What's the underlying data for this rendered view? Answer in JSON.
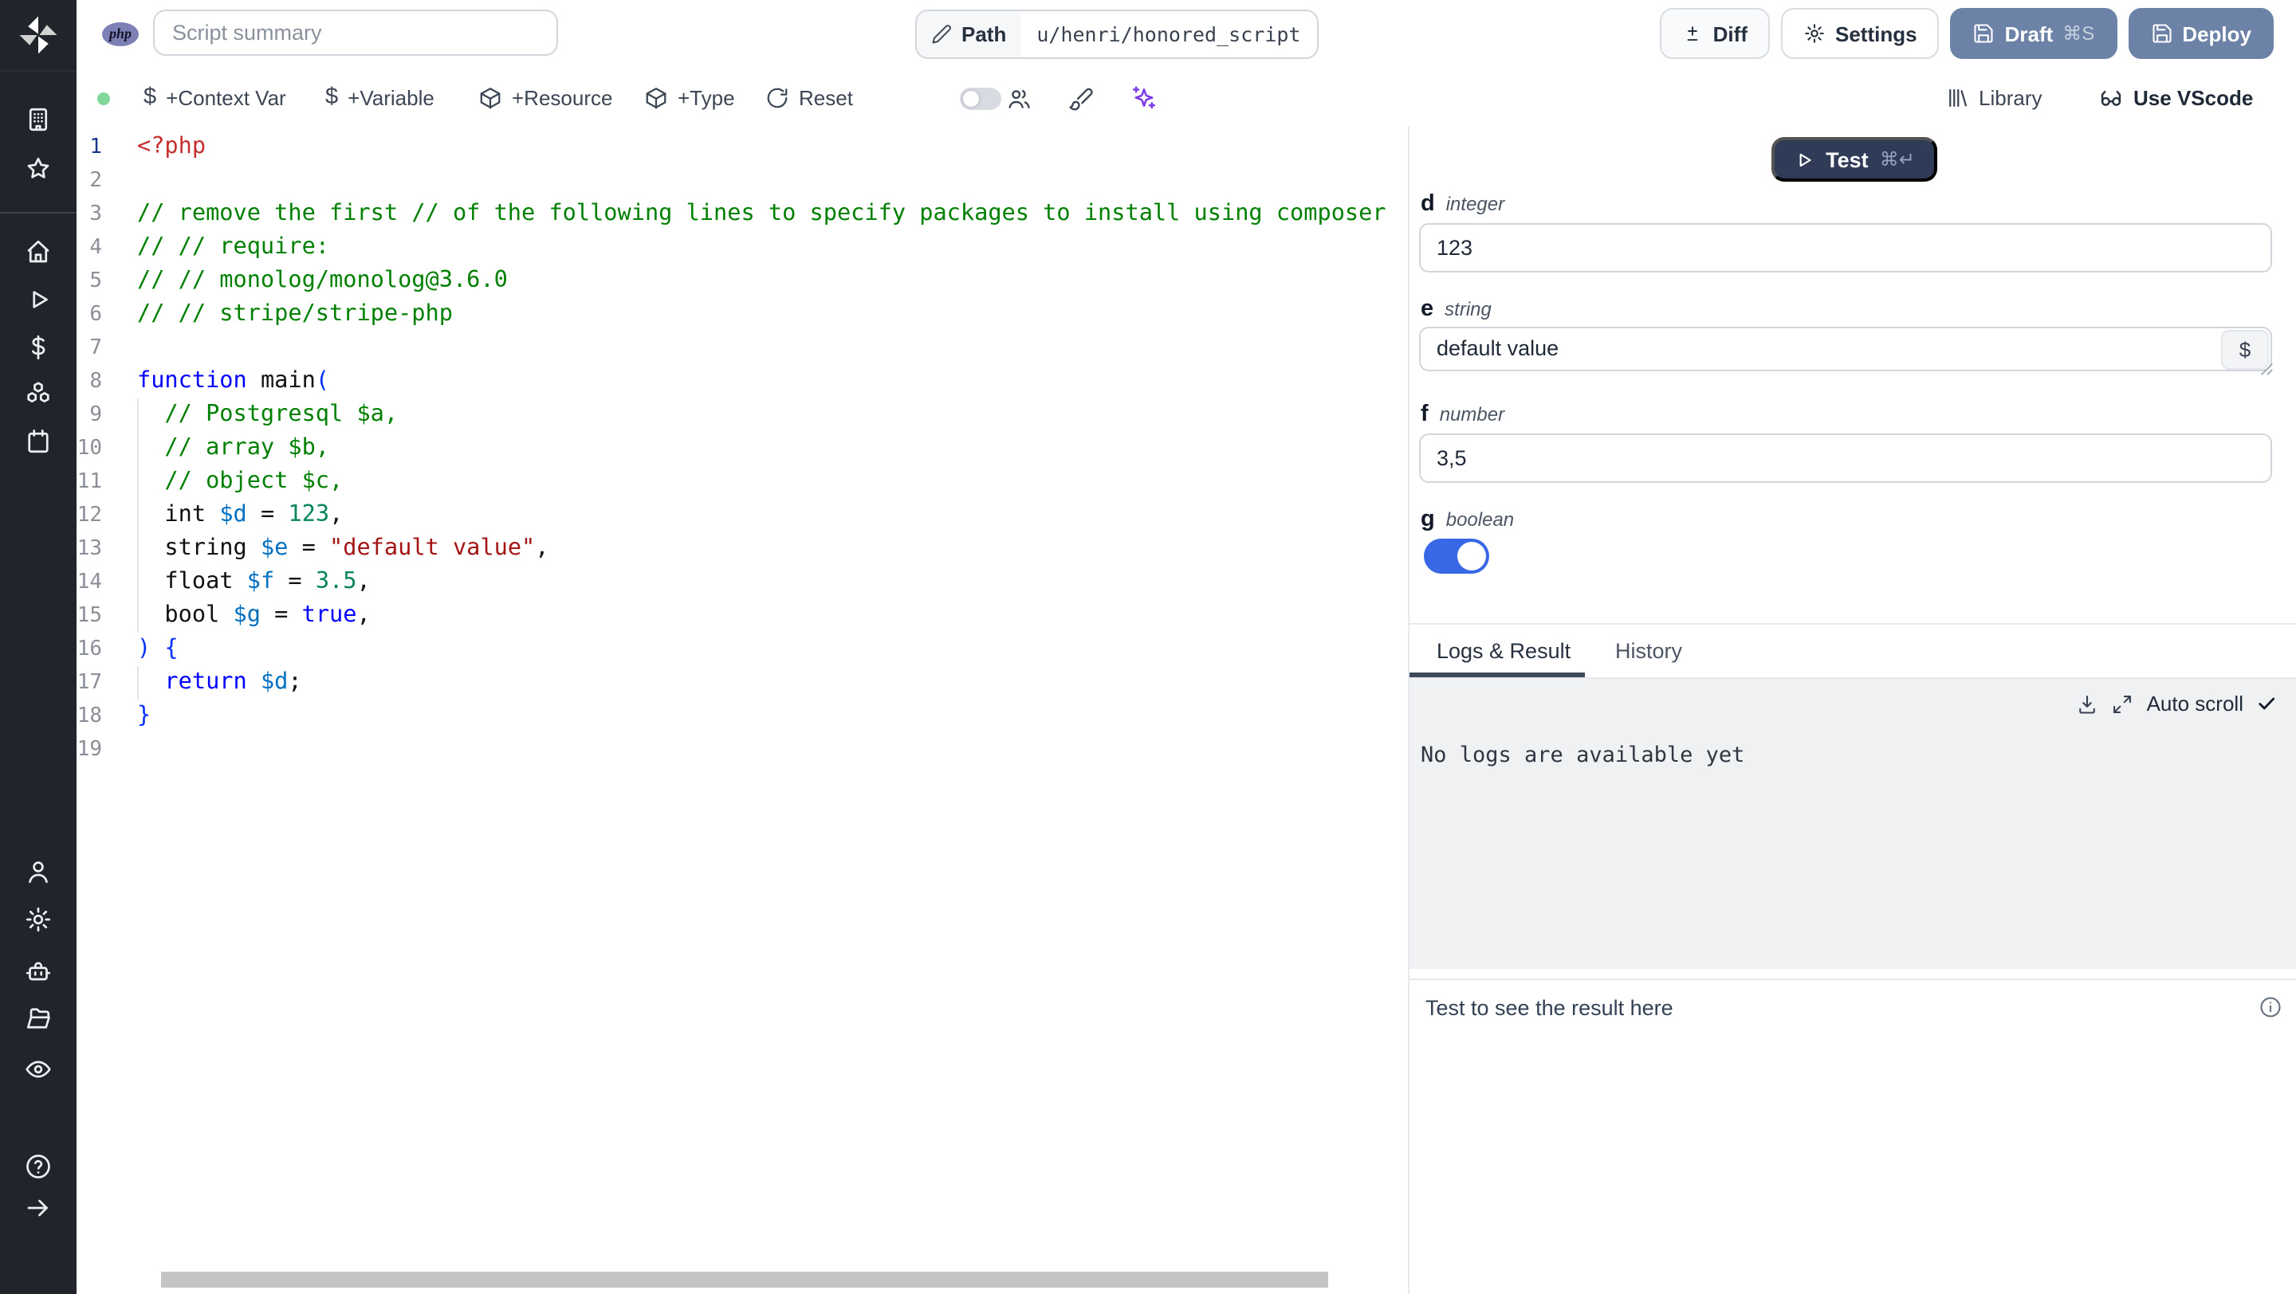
{
  "topbar": {
    "language_badge": "php",
    "summary_placeholder": "Script summary",
    "path": {
      "label": "Path",
      "value": "u/henri/honored_script"
    },
    "buttons": {
      "diff": "Diff",
      "settings": "Settings",
      "draft": "Draft",
      "draft_shortcut": "⌘S",
      "deploy": "Deploy"
    }
  },
  "toolbar": {
    "add_context_var": "+Context Var",
    "add_variable": "+Variable",
    "add_resource": "+Resource",
    "add_type": "+Type",
    "reset": "Reset",
    "diff_mode_toggle_on": false,
    "library": "Library",
    "use_vscode": "Use VScode"
  },
  "editor": {
    "language": "php",
    "active_line": 1,
    "total_lines": 19,
    "lines": [
      [
        [
          "meta",
          "<?php"
        ]
      ],
      [],
      [
        [
          "com",
          "// remove the first // of the following lines to specify packages to install using composer"
        ]
      ],
      [
        [
          "com",
          "// // require:"
        ]
      ],
      [
        [
          "com",
          "// // monolog/monolog@3.6.0"
        ]
      ],
      [
        [
          "com",
          "// // stripe/stripe-php"
        ]
      ],
      [],
      [
        [
          "kw",
          "function"
        ],
        [
          "pl",
          " main"
        ],
        [
          "br",
          "("
        ]
      ],
      [
        [
          "com",
          "  // Postgresql $a,"
        ]
      ],
      [
        [
          "com",
          "  // array $b,"
        ]
      ],
      [
        [
          "com",
          "  // object $c,"
        ]
      ],
      [
        [
          "pl",
          "  int "
        ],
        [
          "var",
          "$d"
        ],
        [
          "pl",
          " = "
        ],
        [
          "num",
          "123"
        ],
        [
          "pl",
          ","
        ]
      ],
      [
        [
          "pl",
          "  string "
        ],
        [
          "var",
          "$e"
        ],
        [
          "pl",
          " = "
        ],
        [
          "str",
          "\"default value\""
        ],
        [
          "pl",
          ","
        ]
      ],
      [
        [
          "pl",
          "  float "
        ],
        [
          "var",
          "$f"
        ],
        [
          "pl",
          " = "
        ],
        [
          "num",
          "3.5"
        ],
        [
          "pl",
          ","
        ]
      ],
      [
        [
          "pl",
          "  bool "
        ],
        [
          "var",
          "$g"
        ],
        [
          "pl",
          " = "
        ],
        [
          "kw",
          "true"
        ],
        [
          "pl",
          ","
        ]
      ],
      [
        [
          "br",
          ") {"
        ]
      ],
      [
        [
          "kw",
          "  return"
        ],
        [
          "pl",
          " "
        ],
        [
          "var",
          "$d"
        ],
        [
          "pl",
          ";"
        ]
      ],
      [
        [
          "br",
          "}"
        ]
      ],
      []
    ]
  },
  "run_panel": {
    "test_label": "Test",
    "test_shortcut": "⌘↵",
    "args": [
      {
        "name": "d",
        "type": "integer",
        "value": "123"
      },
      {
        "name": "e",
        "type": "string",
        "value": "default value"
      },
      {
        "name": "f",
        "type": "number",
        "value": "3,5"
      },
      {
        "name": "g",
        "type": "boolean",
        "value": true
      }
    ],
    "tabs": {
      "logs": "Logs & Result",
      "history": "History",
      "active": "Logs & Result"
    },
    "logs": {
      "auto_scroll": "Auto scroll",
      "empty_message": "No logs are available yet"
    },
    "result_placeholder": "Test to see the result here"
  },
  "sidebar": {
    "icons": [
      "windmill-logo",
      "building",
      "star",
      "home",
      "play",
      "dollar",
      "boxes",
      "calendar",
      "user",
      "settings",
      "robot",
      "folder",
      "eye",
      "help",
      "arrow-right"
    ]
  },
  "colors": {
    "sidebar_bg": "#21242a",
    "status_green": "#7fd89a",
    "toggle_blue": "#3968e7",
    "slate_button": "#6c82a6",
    "test_button": "#2f3b57",
    "ai_purple": "#7c3aed",
    "php_badge": "#7d80b5"
  }
}
